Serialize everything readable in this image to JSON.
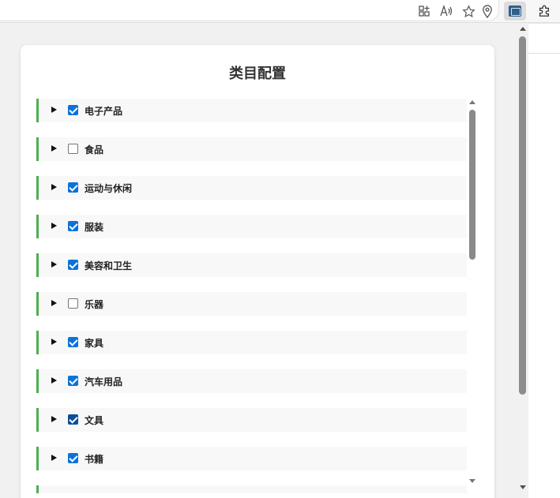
{
  "browser": {
    "toolbar_icons": [
      "app-grid-icon",
      "read-aloud-icon",
      "favorite-star-icon",
      "location-pin-icon",
      "extension-active-icon",
      "extensions-puzzle-icon"
    ],
    "read_aloud_glyph": "A",
    "colors": {
      "toolbar_bg": "#f7f7f7",
      "address_bg": "#ffffff",
      "page_bg": "#f1f1f1"
    }
  },
  "popup": {
    "title": "类目配置",
    "accent_color": "#4caf50",
    "checkbox_color": "#0b72d9",
    "categories": [
      {
        "label": "电子产品",
        "checked": true
      },
      {
        "label": "食品",
        "checked": false
      },
      {
        "label": "运动与休闲",
        "checked": true
      },
      {
        "label": "服装",
        "checked": true
      },
      {
        "label": "美容和卫生",
        "checked": true
      },
      {
        "label": "乐器",
        "checked": false
      },
      {
        "label": "家具",
        "checked": true
      },
      {
        "label": "汽车用品",
        "checked": true
      },
      {
        "label": "文具",
        "checked": true,
        "focused": true
      },
      {
        "label": "书籍",
        "checked": true
      }
    ]
  }
}
